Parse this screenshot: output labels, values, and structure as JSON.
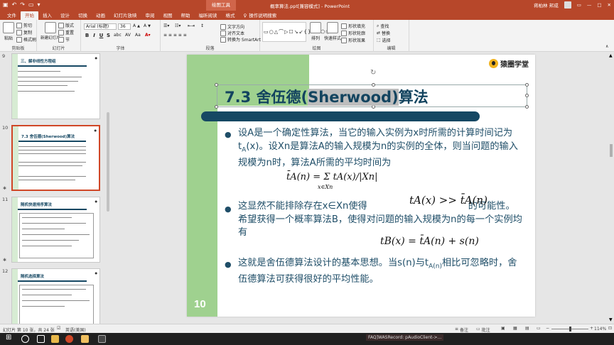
{
  "titlebar": {
    "context_tab": "绘图工具",
    "document_title": "概率算法.ppt[兼容模式] - PowerPoint",
    "user_name": "蒋柏林 邦成",
    "share_label": "共享"
  },
  "tabs": [
    "文件",
    "开始",
    "插入",
    "设计",
    "切换",
    "动画",
    "幻灯片放映",
    "审阅",
    "视图",
    "帮助",
    "福昕阅读",
    "格式"
  ],
  "tell_me": "操作说明搜索",
  "ribbon": {
    "clipboard": {
      "paste": "粘贴",
      "cut": "剪切",
      "copy": "复制",
      "format_painter": "格式刷",
      "label": "剪贴板"
    },
    "slides": {
      "new_slide": "新建幻灯片",
      "layout": "版式",
      "reset": "重置",
      "section": "节",
      "label": "幻灯片"
    },
    "font": {
      "name": "Arial (标题)",
      "size": "36",
      "bold": "B",
      "italic": "I",
      "underline": "U",
      "strike": "S",
      "label": "字体"
    },
    "paragraph": {
      "text_direction": "文字方向",
      "align_text": "对齐文本",
      "smartart": "转换为 SmartArt",
      "label": "段落"
    },
    "drawing": {
      "arrange": "排列",
      "quick_styles": "快速样式",
      "fill": "形状填充",
      "outline": "形状轮廓",
      "effects": "形状效果",
      "label": "绘图"
    },
    "editing": {
      "find": "查找",
      "replace": "替换",
      "select": "选择",
      "label": "编辑"
    }
  },
  "thumbnails": [
    {
      "number": "9",
      "title": "三、解非线性方程组"
    },
    {
      "number": "10",
      "title": "7.3 舍伍德(Sherwood)算法"
    },
    {
      "number": "11",
      "title": "随机快速排序算法"
    },
    {
      "number": "12",
      "title": "随机选择算法"
    }
  ],
  "slide": {
    "number": "10",
    "logo_text": "猿圈学堂",
    "title_prefix": "7.3 舍伍德(",
    "title_highlight": "Sherwood)",
    "title_suffix": "算法",
    "para1": "设A是一个确定性算法，当它的输入实例为x时所需的计算时间记为t",
    "para1_sub": "A",
    "para1_rest": "(x)。设Xn是算法A的输入规模为n的实例的全体，则当问题的输入规模为n时，算法A所需的平均时间为",
    "para2_a": "这显然不能排除存在x∈Xn使得",
    "para2_b": "的可能性。希望获得一个概率算法B，使得对问题的输入规模为n的每一个实例均有",
    "para3": "这就是舍伍德算法设计的基本思想。当s(n)与t",
    "para3_sub": "A(n)",
    "para3_rest": "相比可忽略时，舍伍德算法可获得很好的平均性能。",
    "formula1": "t̄A(n) = Σ tA(x)/|Xn|",
    "formula1_sub": "x∈Xn",
    "formula2": "tA(x) >> t̄A(n)",
    "formula3": "tB(x) = t̄A(n) + s(n)"
  },
  "statusbar": {
    "slide_info": "幻灯片 第 10 张，共 24 张",
    "language": "英语(美国)",
    "notes": "备注",
    "comments": "批注",
    "zoom": "114%"
  },
  "taskbar": {
    "tray_text": "FAQ]WASRecord: pAudioClient->..."
  }
}
